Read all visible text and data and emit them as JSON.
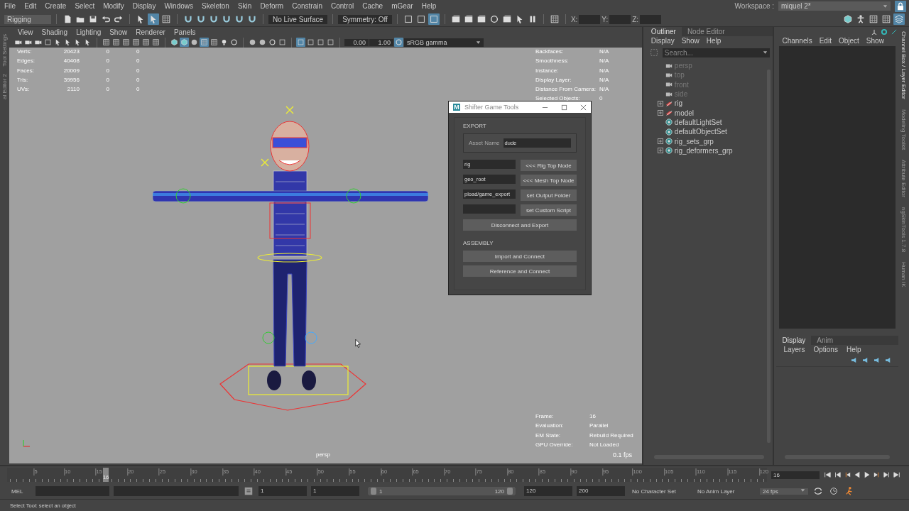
{
  "menubar": {
    "menus": [
      "File",
      "Edit",
      "Create",
      "Select",
      "Modify",
      "Display",
      "Windows",
      "Skeleton",
      "Skin",
      "Deform",
      "Constrain",
      "Control",
      "Cache",
      "mGear",
      "Help"
    ],
    "workspace_label": "Workspace :",
    "workspace": "miquel 2*",
    "lock": {
      "selected": true
    }
  },
  "toolbar": {
    "mode": "Rigging",
    "live_surface": "No Live Surface",
    "symmetry": "Symmetry: Off",
    "coord_labels": [
      "X:",
      "Y:",
      "Z:"
    ],
    "groups": [
      {
        "buttons": [
          {
            "selected": false
          },
          {
            "selected": false
          },
          {
            "selected": false
          },
          {
            "selected": false
          },
          {
            "selected": false
          }
        ]
      },
      {
        "buttons": [
          {
            "selected": false
          },
          {
            "selected": true
          },
          {
            "selected": false
          }
        ]
      },
      {
        "buttons": [
          {
            "selected": false
          },
          {
            "selected": false
          },
          {
            "selected": false
          },
          {
            "selected": false
          },
          {
            "selected": false
          },
          {
            "selected": false
          }
        ]
      },
      {
        "buttons": [
          {
            "selected": false
          },
          {
            "selected": false
          },
          {
            "selected": true
          }
        ]
      },
      {
        "buttons": [
          {
            "selected": false
          },
          {
            "selected": false
          },
          {
            "selected": false
          },
          {
            "selected": false
          },
          {
            "selected": false
          },
          {
            "selected": false
          },
          {
            "selected": false
          }
        ]
      },
      {
        "buttons": [
          {
            "selected": false
          }
        ]
      }
    ],
    "right_buttons": [
      {
        "selected": false
      },
      {
        "selected": false
      },
      {
        "selected": false
      },
      {
        "selected": false
      },
      {
        "selected": true
      }
    ]
  },
  "side_tabs_left": [
    "Tool Settings",
    "al Editor 2"
  ],
  "viewport": {
    "menus": [
      "View",
      "Shading",
      "Lighting",
      "Show",
      "Renderer",
      "Panels"
    ],
    "groups": [
      {
        "buttons": [
          {
            "selected": false
          },
          {
            "selected": false
          },
          {
            "selected": false
          },
          {
            "selected": false
          },
          {
            "selected": false
          },
          {
            "selected": false
          },
          {
            "selected": false
          },
          {
            "selected": false
          }
        ]
      },
      {
        "buttons": [
          {
            "selected": false
          },
          {
            "selected": false
          },
          {
            "selected": false
          },
          {
            "selected": false
          },
          {
            "selected": false
          },
          {
            "selected": false
          }
        ]
      },
      {
        "buttons": [
          {
            "selected": false
          },
          {
            "selected": true
          },
          {
            "selected": false
          },
          {
            "selected": true
          },
          {
            "selected": false
          },
          {
            "selected": false
          },
          {
            "selected": false
          }
        ]
      },
      {
        "buttons": [
          {
            "selected": false
          },
          {
            "selected": false
          },
          {
            "selected": false
          },
          {
            "selected": false
          }
        ]
      },
      {
        "buttons": [
          {
            "selected": true
          },
          {
            "selected": false
          },
          {
            "selected": false
          },
          {
            "selected": false
          }
        ]
      }
    ],
    "exposure": "0.00",
    "gamma": "1.00",
    "color_management": {
      "selected": true
    },
    "color_space": "sRGB gamma",
    "stats": [
      {
        "label": "Verts:",
        "values": [
          "20423",
          "0",
          "0"
        ]
      },
      {
        "label": "Edges:",
        "values": [
          "40408",
          "0",
          "0"
        ]
      },
      {
        "label": "Faces:",
        "values": [
          "20009",
          "0",
          "0"
        ]
      },
      {
        "label": "Tris:",
        "values": [
          "39956",
          "0",
          "0"
        ]
      },
      {
        "label": "UVs:",
        "values": [
          "2110",
          "0",
          "0"
        ]
      }
    ],
    "info": [
      {
        "label": "Backfaces:",
        "value": "N/A"
      },
      {
        "label": "Smoothness:",
        "value": "N/A"
      },
      {
        "label": "Instance:",
        "value": "N/A"
      },
      {
        "label": "Display Layer:",
        "value": "N/A"
      },
      {
        "label": "Distance From Camera:",
        "value": "N/A"
      },
      {
        "label": "Selected Objects:",
        "value": "0"
      }
    ],
    "status": [
      {
        "label": "Frame:",
        "value": "16"
      },
      {
        "label": "Evaluation:",
        "value": "Parallel"
      },
      {
        "label": "EM State:",
        "value": "Rebuild Required"
      },
      {
        "label": "GPU Override:",
        "value": "Not Loaded"
      }
    ],
    "fps": "0.1 fps",
    "camera": "persp"
  },
  "dialog": {
    "logo": "M",
    "title": "Shifter Game Tools",
    "export_label": "EXPORT",
    "asset_label": "Asset Name",
    "asset_value": "dude",
    "rows": [
      {
        "value": "rig",
        "button": "<<< Rig Top Node"
      },
      {
        "value": "geo_root",
        "button": "<<< Mesh Top Node"
      },
      {
        "value": "pload/game_export",
        "button": "set Output Folder"
      },
      {
        "value": "",
        "button": "set Custom Script"
      }
    ],
    "export_button": "Disconnect and Export",
    "assembly_label": "ASSEMBLY",
    "assembly_buttons": [
      "Import and Connect",
      "Reference and Connect"
    ]
  },
  "outliner": {
    "tabs": [
      {
        "label": "Outliner",
        "selected": true
      },
      {
        "label": "Node Editor",
        "selected": false
      }
    ],
    "menus": [
      "Display",
      "Show",
      "Help"
    ],
    "placeholder": "Search...",
    "items": [
      {
        "label": "persp",
        "kind": "camera",
        "dimmed": true,
        "expandable": false
      },
      {
        "label": "top",
        "kind": "camera",
        "dimmed": true,
        "expandable": false
      },
      {
        "label": "front",
        "kind": "camera",
        "dimmed": true,
        "expandable": false
      },
      {
        "label": "side",
        "kind": "camera",
        "dimmed": true,
        "expandable": false
      },
      {
        "label": "rig",
        "kind": "group",
        "dimmed": false,
        "expandable": true
      },
      {
        "label": "model",
        "kind": "group",
        "dimmed": false,
        "expandable": true
      },
      {
        "label": "defaultLightSet",
        "kind": "set",
        "dimmed": false,
        "expandable": false
      },
      {
        "label": "defaultObjectSet",
        "kind": "set",
        "dimmed": false,
        "expandable": false
      },
      {
        "label": "rig_sets_grp",
        "kind": "set",
        "dimmed": false,
        "expandable": true
      },
      {
        "label": "rig_deformers_grp",
        "kind": "set",
        "dimmed": false,
        "expandable": true
      }
    ]
  },
  "channel_box": {
    "menus": [
      "Channels",
      "Edit",
      "Object",
      "Show"
    ]
  },
  "layer_editor": {
    "tabs": [
      {
        "label": "Display",
        "selected": true
      },
      {
        "label": "Anim",
        "selected": false
      }
    ],
    "menus": [
      "Layers",
      "Options",
      "Help"
    ]
  },
  "side_tabs_right": [
    "Channel Box / Layer Editor",
    "Modeling Toolkit",
    "Attribute Editor",
    "ngSkinTools 1.7.8",
    "Human IK"
  ],
  "timeline": {
    "ticks": [
      "5",
      "10",
      "15",
      "20",
      "25",
      "30",
      "35",
      "40",
      "45",
      "50",
      "55",
      "60",
      "65",
      "70",
      "75",
      "80",
      "85",
      "90",
      "95",
      "100",
      "105",
      "110",
      "115",
      "120"
    ],
    "current_frame": "16",
    "level": 0.129,
    "frame_field": "16"
  },
  "range": {
    "language": "MEL",
    "start": "1",
    "playback_start": "1",
    "slider_start": "1",
    "slider_end": "120",
    "level": 1,
    "playback_end": "120",
    "end": "200",
    "character_set": "No Character Set",
    "anim_layer": "No Anim Layer",
    "fps": "24 fps"
  },
  "help_line": "Select Tool: select an object"
}
